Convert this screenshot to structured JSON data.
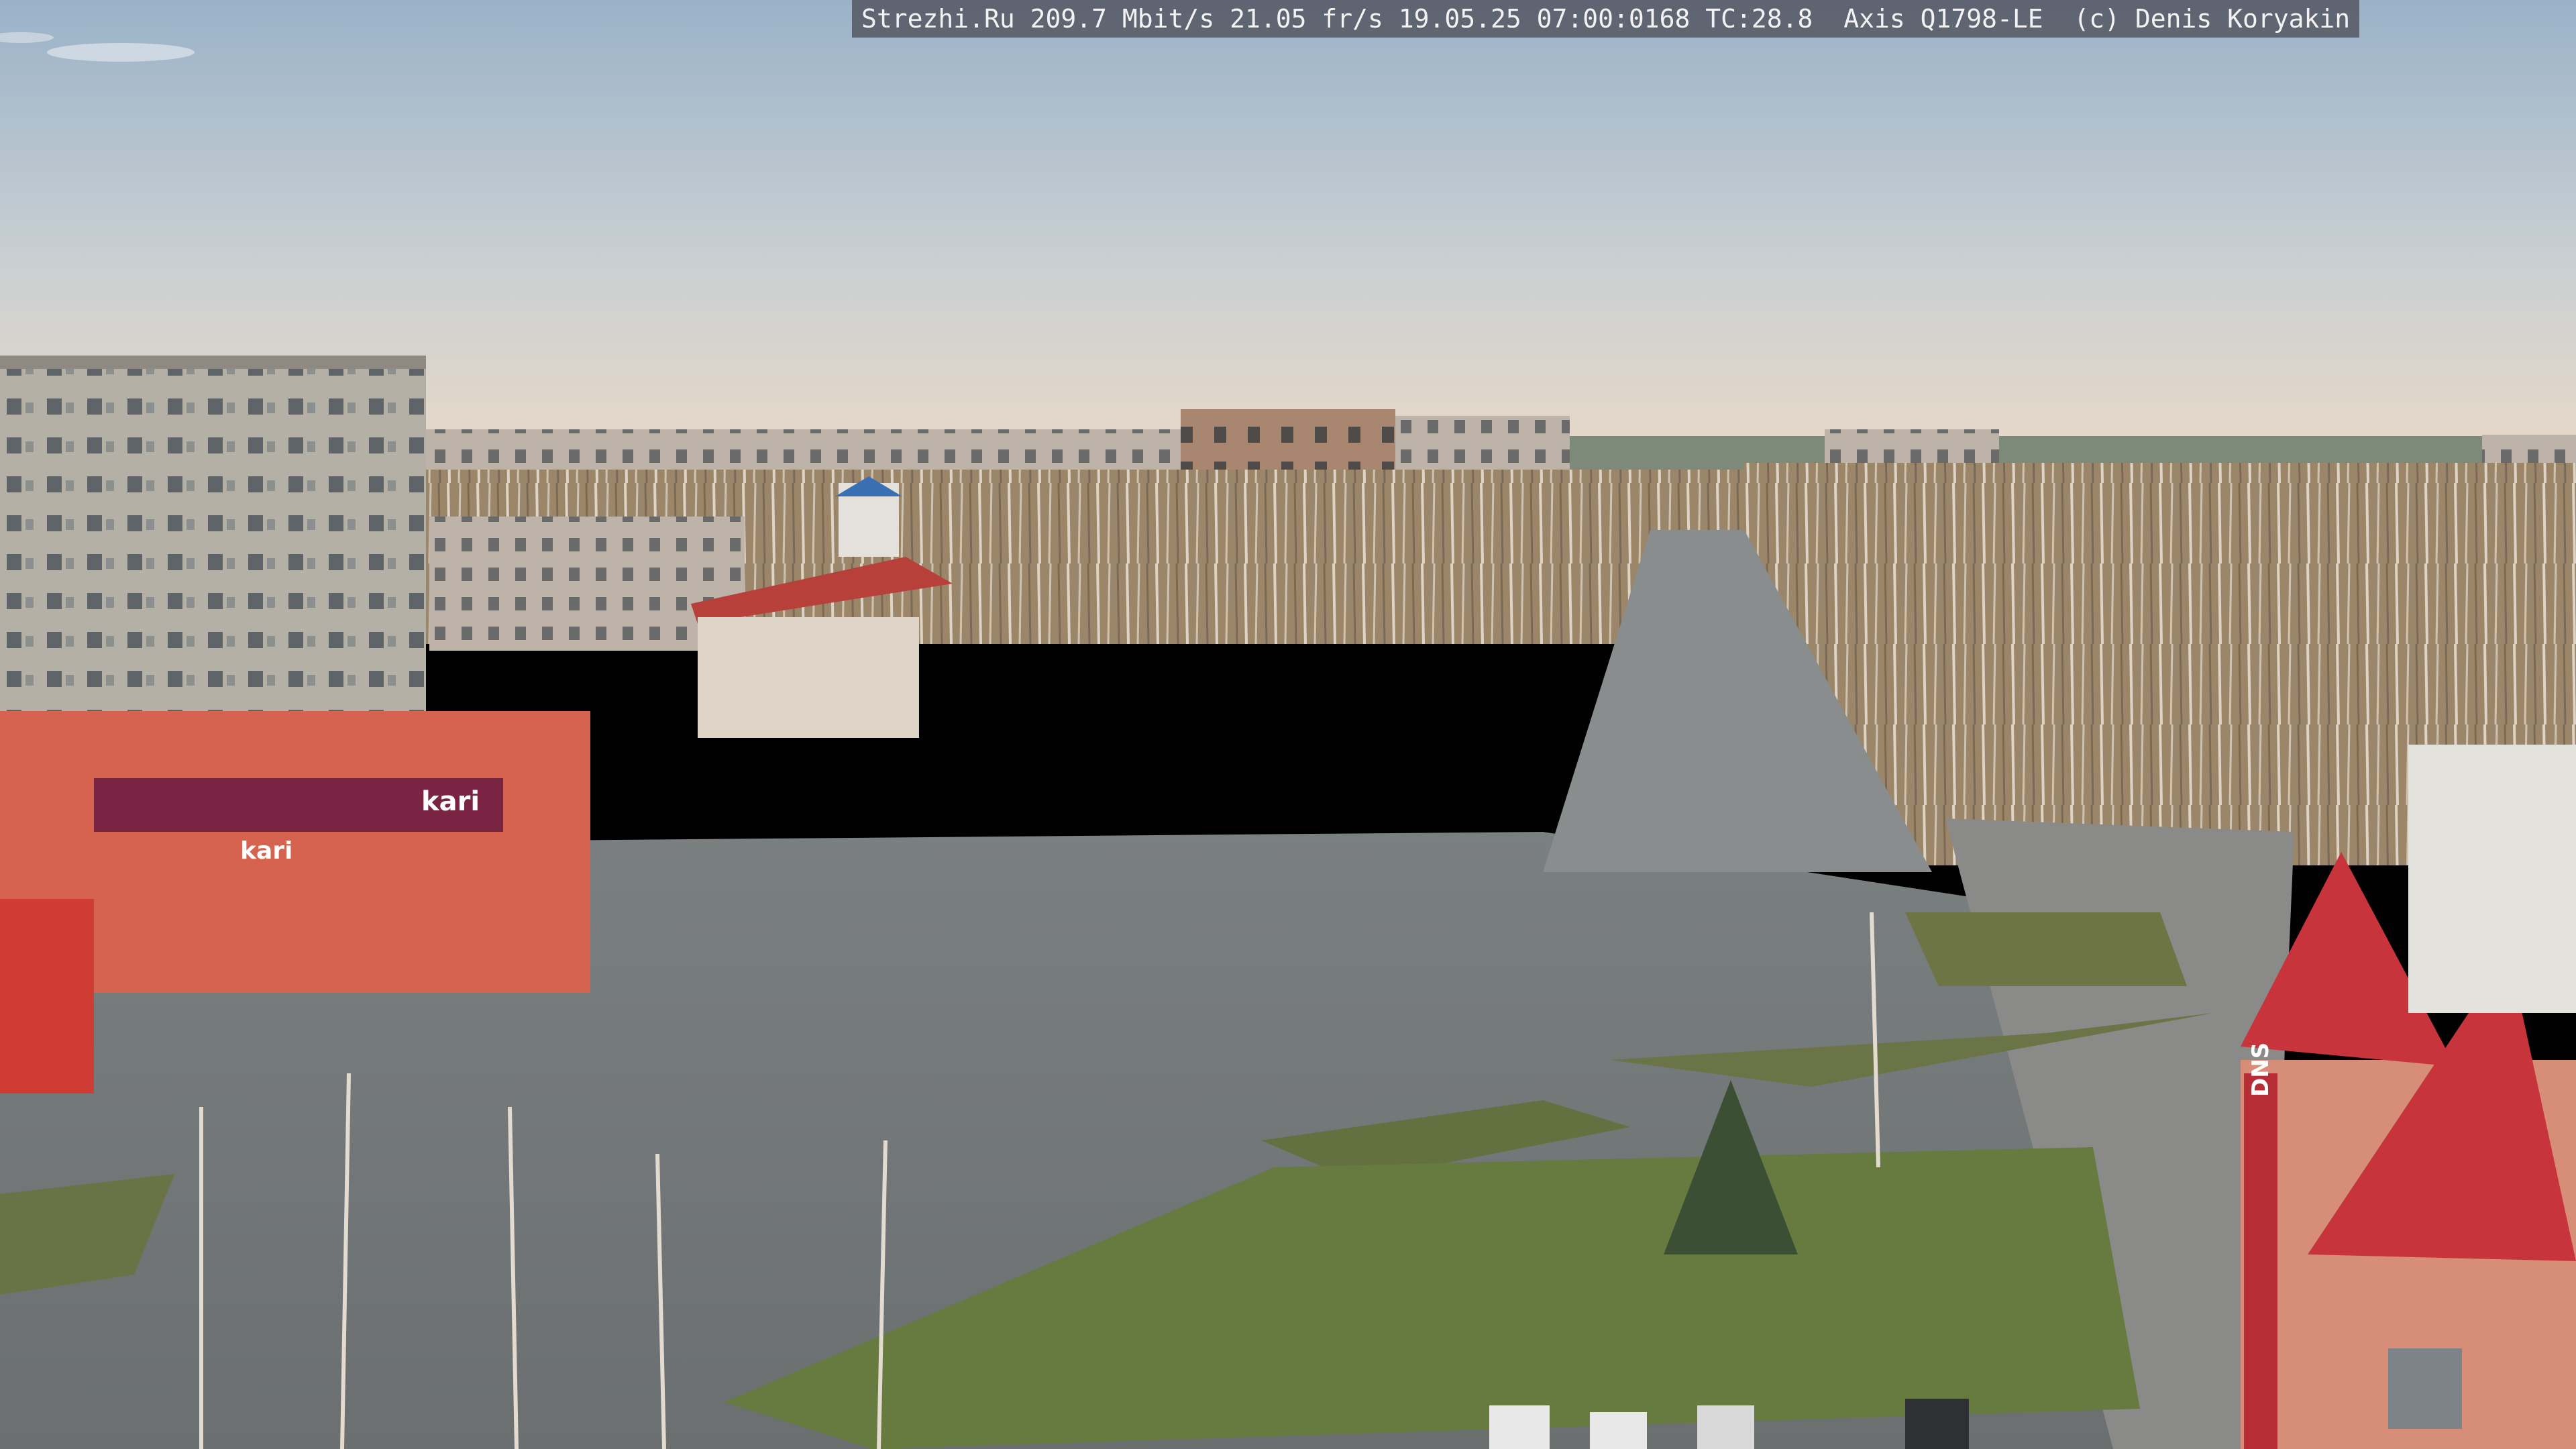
{
  "overlay": {
    "text": "Strezhi.Ru 209.7 Mbit/s 21.05 fr/s 19.05.25 07:00:0168 TC:28.8  Axis Q1798-LE  (c) Denis Koryakin"
  },
  "signs": {
    "kari_large": "kari",
    "kari_small": "kari",
    "dns": "DNS"
  },
  "colors": {
    "sky_top": "#9fb6cc",
    "sky_horizon": "#e7d8c9",
    "building_gray": "#b7b2a8",
    "roof_red": "#c83a3a",
    "storefront_red": "#d5634f",
    "road": "#7d8285",
    "grass": "#6f7d4a"
  }
}
